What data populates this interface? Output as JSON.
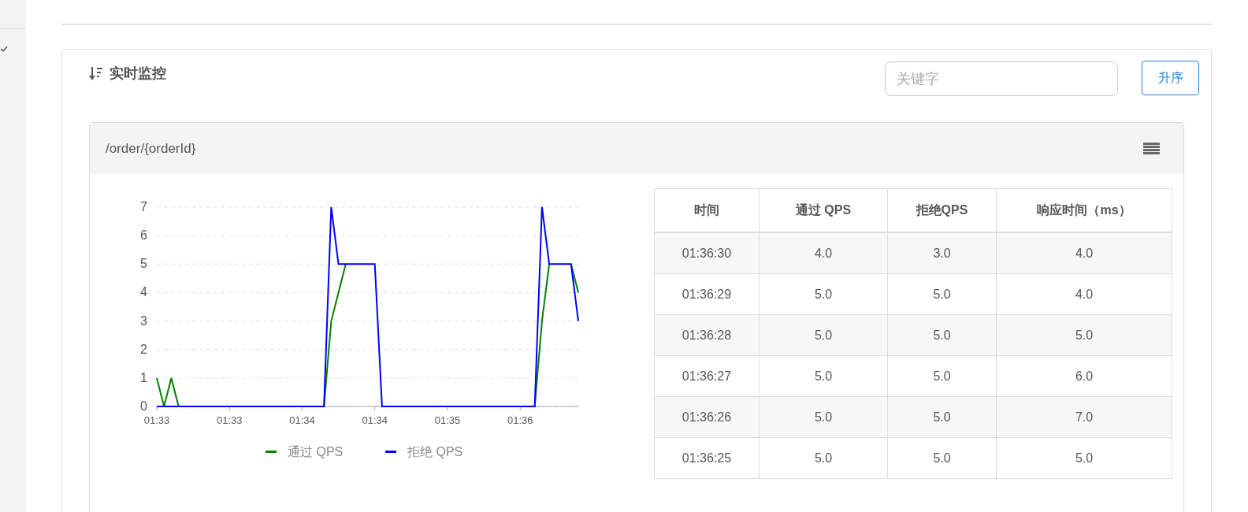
{
  "section": {
    "title": "实时监控",
    "search": {
      "placeholder": "关键字"
    },
    "sort_button": "升序"
  },
  "resource": {
    "title": "/order/{orderId}",
    "chart_data": {
      "type": "line",
      "categories": [
        "01:33",
        null,
        null,
        null,
        null,
        null,
        null,
        null,
        null,
        null,
        "01:33",
        null,
        null,
        null,
        null,
        null,
        null,
        null,
        null,
        null,
        "01:34",
        null,
        null,
        null,
        null,
        null,
        null,
        null,
        null,
        null,
        "01:34",
        null,
        null,
        null,
        null,
        null,
        null,
        null,
        null,
        null,
        "01:35",
        null,
        null,
        null,
        null,
        null,
        null,
        null,
        null,
        null,
        "01:36",
        null,
        null,
        null,
        null,
        null,
        null,
        null,
        null
      ],
      "series": [
        {
          "name": "通过 QPS",
          "color": "#008000",
          "values": [
            1,
            0,
            1,
            0,
            null,
            null,
            null,
            null,
            null,
            null,
            null,
            null,
            null,
            null,
            null,
            null,
            null,
            null,
            null,
            null,
            null,
            null,
            null,
            0,
            3,
            4,
            5,
            null,
            null,
            null,
            null,
            null,
            null,
            null,
            null,
            null,
            null,
            null,
            null,
            null,
            null,
            null,
            null,
            null,
            null,
            null,
            null,
            null,
            null,
            null,
            null,
            null,
            0,
            3,
            5,
            null,
            null,
            5,
            4
          ]
        },
        {
          "name": "拒绝 QPS",
          "color": "#0000ff",
          "values": [
            0,
            0,
            0,
            0,
            0,
            0,
            0,
            0,
            0,
            0,
            0,
            0,
            0,
            0,
            0,
            0,
            0,
            0,
            0,
            0,
            0,
            0,
            0,
            0,
            7,
            5,
            5,
            5,
            5,
            5,
            5,
            0,
            0,
            0,
            0,
            0,
            0,
            0,
            0,
            0,
            0,
            0,
            0,
            0,
            0,
            0,
            0,
            0,
            0,
            0,
            0,
            0,
            0,
            7,
            5,
            5,
            5,
            5,
            3
          ]
        }
      ],
      "ylim": [
        0,
        7
      ],
      "grid": true,
      "legend": true,
      "yticks": [
        0,
        1,
        2,
        3,
        4,
        5,
        6,
        7
      ]
    },
    "table": {
      "columns": [
        "时间",
        "通过 QPS",
        "拒绝QPS",
        "响应时间（ms）"
      ],
      "rows": [
        [
          "01:36:30",
          "4.0",
          "3.0",
          "4.0"
        ],
        [
          "01:36:29",
          "5.0",
          "5.0",
          "4.0"
        ],
        [
          "01:36:28",
          "5.0",
          "5.0",
          "5.0"
        ],
        [
          "01:36:27",
          "5.0",
          "5.0",
          "6.0"
        ],
        [
          "01:36:26",
          "5.0",
          "5.0",
          "7.0"
        ],
        [
          "01:36:25",
          "5.0",
          "5.0",
          "5.0"
        ]
      ]
    }
  }
}
